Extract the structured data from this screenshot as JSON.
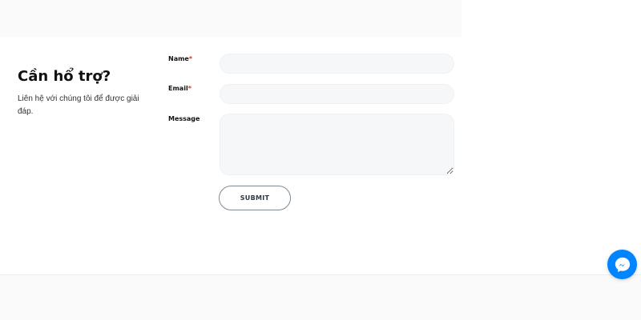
{
  "help": {
    "title": "Cần hổ trợ?",
    "description": "Liên hệ với chúng tôi để được giải đáp."
  },
  "form": {
    "name_label": "Name",
    "email_label": "Email",
    "message_label": "Message",
    "required_mark": "*",
    "name_value": "",
    "email_value": "",
    "message_value": "",
    "submit_label": "SUBMIT"
  },
  "messenger": {
    "icon": "messenger-icon",
    "color": "#0084ff"
  },
  "colors": {
    "required": "#c0392b",
    "input_bg": "#f5f7f8",
    "button_border": "#7d8a96"
  }
}
